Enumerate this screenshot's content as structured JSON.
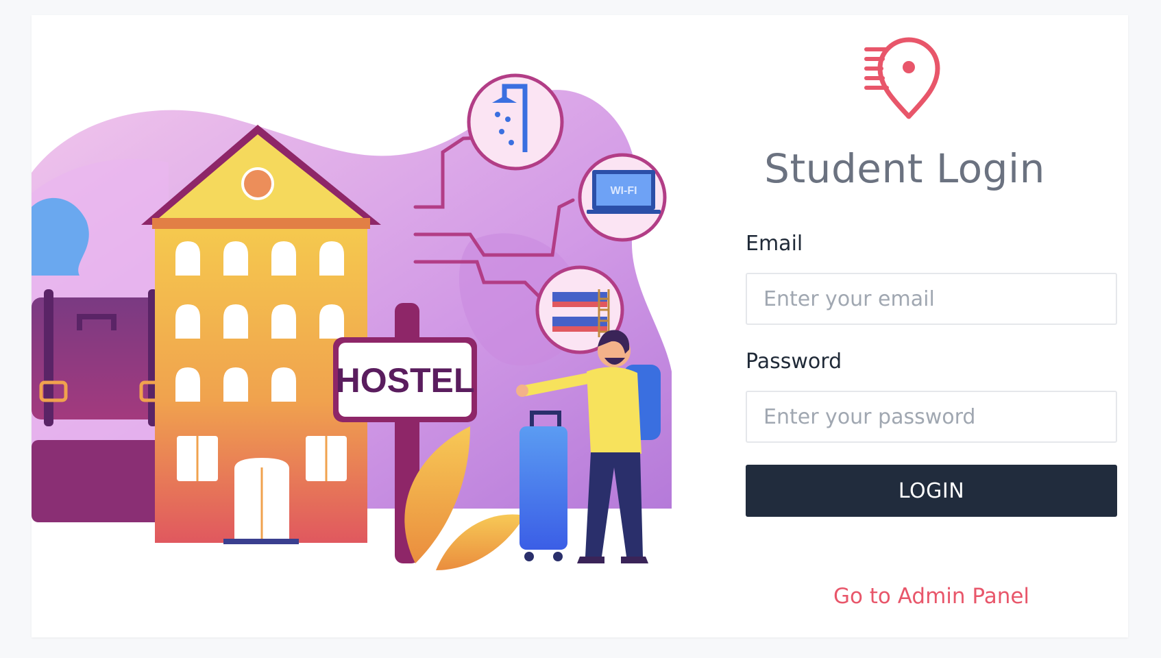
{
  "login": {
    "title": "Student Login",
    "email_label": "Email",
    "email_placeholder": "Enter your email",
    "password_label": "Password",
    "password_placeholder": "Enter your password",
    "login_button": "LOGIN",
    "admin_link": "Go to Admin Panel"
  },
  "illustration": {
    "sign_text": "HOSTEL",
    "laptop_text": "WI-FI"
  },
  "icons": {
    "logo": "location-pin-speed-icon"
  },
  "colors": {
    "accent": "#e8566a",
    "button": "#212c3d",
    "title": "#6b7280",
    "label": "#1f2937"
  }
}
